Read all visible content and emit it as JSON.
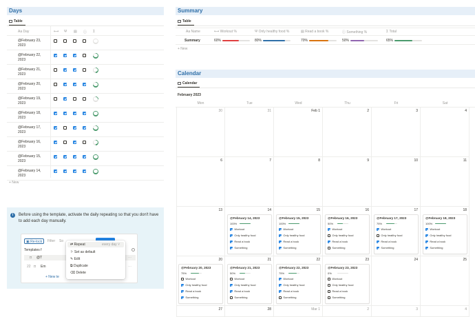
{
  "days": {
    "title": "Days",
    "tab": "Table",
    "col_day": "Day",
    "rows": [
      {
        "date": "@February 23, 2023",
        "checks": [
          false,
          false,
          false,
          false
        ],
        "progress": 0
      },
      {
        "date": "@February 22, 2023",
        "checks": [
          true,
          true,
          true,
          false
        ],
        "progress": 0.75
      },
      {
        "date": "@February 21, 2023",
        "checks": [
          false,
          true,
          true,
          false
        ],
        "progress": 0.5
      },
      {
        "date": "@February 20, 2023",
        "checks": [
          false,
          true,
          true,
          true
        ],
        "progress": 0.75
      },
      {
        "date": "@February 19, 2023",
        "checks": [
          false,
          true,
          false,
          false
        ],
        "progress": 0.25
      },
      {
        "date": "@February 18, 2023",
        "checks": [
          true,
          true,
          true,
          true
        ],
        "progress": 1
      },
      {
        "date": "@February 17, 2023",
        "checks": [
          true,
          false,
          true,
          true
        ],
        "progress": 0.75
      },
      {
        "date": "@February 16, 2023",
        "checks": [
          true,
          false,
          true,
          false
        ],
        "progress": 0.5
      },
      {
        "date": "@February 15, 2023",
        "checks": [
          true,
          true,
          true,
          true
        ],
        "progress": 1
      },
      {
        "date": "@February 14, 2023",
        "checks": [
          true,
          true,
          true,
          true
        ],
        "progress": 1
      }
    ],
    "new_label": "+ New"
  },
  "callout": {
    "text": "Before using the template, activate the daily repeating so that you don't have to add each day manually.",
    "shot": {
      "relock": "Re-lock",
      "filter": "Filter",
      "sort": "So",
      "templates": "Templates f",
      "row_num": "22",
      "at": "@T",
      "em": "Em",
      "new": "+ New te"
    },
    "menu": {
      "items": [
        "Repeat",
        "Set as default",
        "Edit",
        "Duplicate",
        "Delete"
      ],
      "repeat_value": "every day"
    }
  },
  "summary": {
    "title": "Summary",
    "tab": "Table",
    "columns": [
      "Name",
      "Workout %",
      "Only healthy food %",
      "Read a book %",
      "Something %",
      "Total"
    ],
    "row": {
      "name": "Summary",
      "values": [
        "60%",
        "80%",
        "70%",
        "50%",
        "65%"
      ],
      "fractions": [
        0.6,
        0.8,
        0.7,
        0.5,
        0.65
      ]
    },
    "bar_colors": [
      "#e03e3e",
      "#2f6fa8",
      "#d9730d",
      "#9065b0",
      "#4a9a6c"
    ],
    "new_label": "+ New"
  },
  "calendar": {
    "title": "Calendar",
    "tab": "Calendar",
    "month": "February 2023",
    "weekdays": [
      "Mon",
      "Tue",
      "Wed",
      "Thu",
      "Fri",
      "Sat"
    ],
    "weeks": [
      [
        "30",
        "31",
        "Feb 1",
        "2",
        "3",
        "4"
      ],
      [
        "6",
        "7",
        "8",
        "9",
        "10",
        "11"
      ],
      [
        "13",
        "14",
        "15",
        "16",
        "17",
        "18"
      ],
      [
        "20",
        "21",
        "22",
        "23",
        "24",
        "25"
      ],
      [
        "27",
        "28",
        "Mar 1",
        "2",
        "3",
        "4"
      ]
    ],
    "habits": [
      "Workout",
      "Only healthy food",
      "Read a book",
      "Something"
    ],
    "cards": [
      {
        "title": "@February 14, 2023",
        "pct": "100%",
        "progress": 1,
        "checks": [
          true,
          true,
          true,
          true
        ]
      },
      {
        "title": "@February 15, 2023",
        "pct": "100%",
        "progress": 1,
        "checks": [
          true,
          true,
          true,
          true
        ]
      },
      {
        "title": "@February 16, 2023",
        "pct": "50%",
        "progress": 0.5,
        "checks": [
          true,
          false,
          true,
          false
        ]
      },
      {
        "title": "@February 17, 2023",
        "pct": "75%",
        "progress": 0.75,
        "checks": [
          true,
          false,
          true,
          true
        ]
      },
      {
        "title": "@February 18, 2023",
        "pct": "100%",
        "progress": 1,
        "checks": [
          true,
          true,
          true,
          true
        ]
      },
      {
        "title": "@February 20, 2023",
        "pct": "75%",
        "progress": 0.75,
        "checks": [
          false,
          true,
          true,
          true
        ]
      },
      {
        "title": "@February 21, 2023",
        "pct": "50%",
        "progress": 0.5,
        "checks": [
          false,
          true,
          true,
          false
        ]
      },
      {
        "title": "@February 22, 2023",
        "pct": "75%",
        "progress": 0.75,
        "checks": [
          true,
          true,
          true,
          false
        ]
      },
      {
        "title": "@February 23, 2023",
        "pct": "0%",
        "progress": 0,
        "checks": [
          false,
          false,
          false,
          false
        ]
      }
    ]
  },
  "icons": {
    "table": "table-icon",
    "calendar": "calendar-icon",
    "info": "info-icon"
  }
}
